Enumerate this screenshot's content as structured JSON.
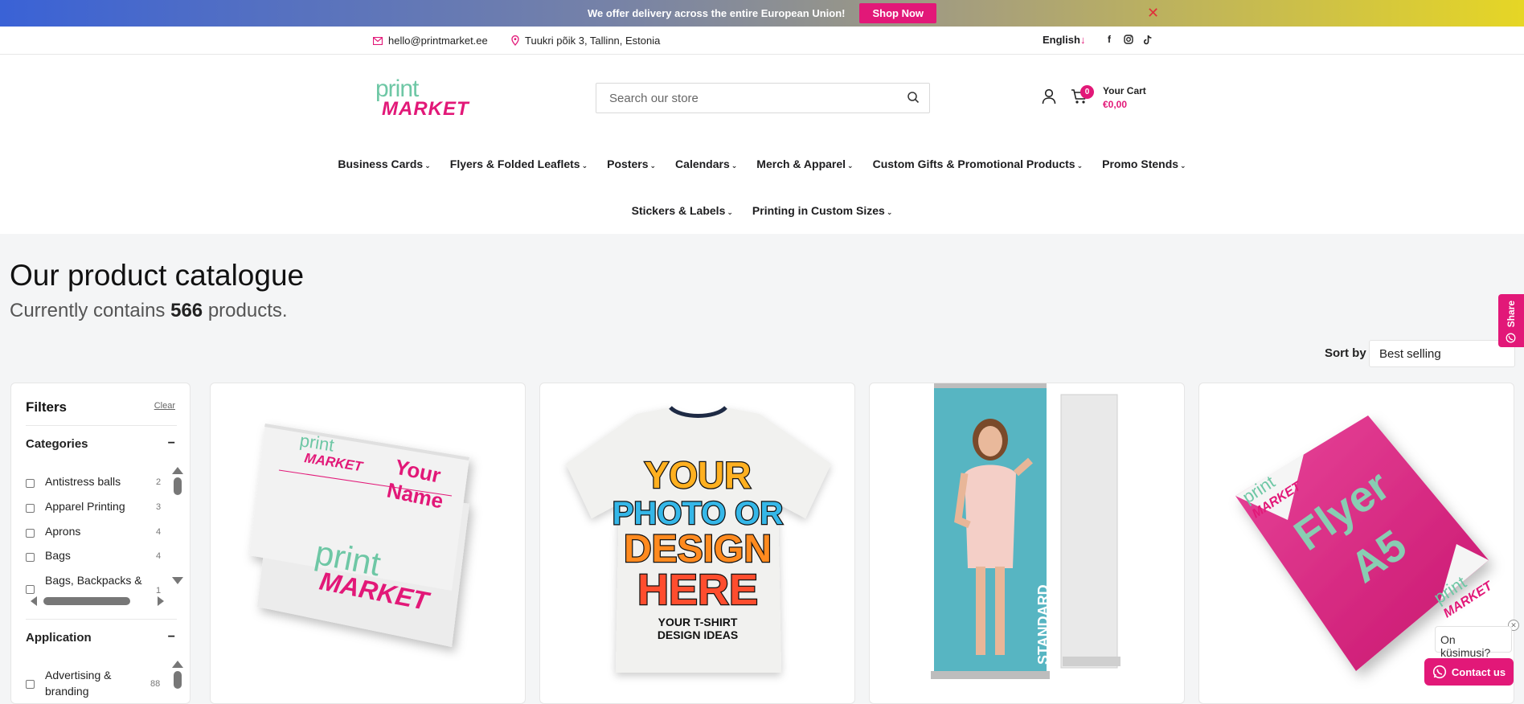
{
  "announcement": {
    "message": "We offer delivery across the entire European Union!",
    "cta": "Shop Now"
  },
  "topbar": {
    "email": "hello@printmarket.ee",
    "address": "Tuukri põik 3, Tallinn, Estonia",
    "language": "English",
    "language_arrow": "↓"
  },
  "logo": {
    "line1": "print",
    "line2": "MARKET"
  },
  "search": {
    "placeholder": "Search our store"
  },
  "cart": {
    "count": "0",
    "title": "Your Cart",
    "total": "€0,00"
  },
  "nav": {
    "row1": [
      "Business Cards",
      "Flyers & Folded Leaflets",
      "Posters",
      "Calendars",
      "Merch & Apparel",
      "Custom Gifts & Promotional Products",
      "Promo Stends"
    ],
    "row2": [
      "Stickers & Labels",
      "Printing in Custom Sizes"
    ]
  },
  "catalogue": {
    "title": "Our product catalogue",
    "subtitle_prefix": "Currently contains",
    "count": "566",
    "subtitle_suffix": "products."
  },
  "sort": {
    "label": "Sort by",
    "value": "Best selling"
  },
  "share": {
    "label": "Share"
  },
  "filters": {
    "title": "Filters",
    "clear": "Clear",
    "categories": {
      "title": "Categories",
      "toggle": "−",
      "items": [
        {
          "label": "Antistress balls",
          "count": "2"
        },
        {
          "label": "Apparel Printing",
          "count": "3"
        },
        {
          "label": "Aprons",
          "count": "4"
        },
        {
          "label": "Bags",
          "count": "4"
        },
        {
          "label": "Bags, Backpacks &",
          "count": "1"
        }
      ]
    },
    "application": {
      "title": "Application",
      "toggle": "−",
      "items": [
        {
          "label": "Advertising &",
          "label2": "branding",
          "count": "88"
        }
      ]
    }
  },
  "products": [
    {
      "name": "Business cards",
      "card_name": "Your",
      "card_name2": "Name",
      "brand1": "print",
      "brand2": "MARKET"
    },
    {
      "name": "T-shirt",
      "l1": "YOUR",
      "l2": "PHOTO OR",
      "l3": "DESIGN",
      "l4": "HERE",
      "l5": "YOUR T-SHIRT",
      "l6": "DESIGN IDEAS"
    },
    {
      "name": "Roll-up banner",
      "side": "STANDARD"
    },
    {
      "name": "Flyer A5",
      "f1": "Flyer",
      "f2": "A5",
      "brand1": "print",
      "brand2": "MARKET"
    }
  ],
  "chat": {
    "question": "On küsimusi?",
    "contact": "Contact us"
  },
  "colors": {
    "accent": "#e21878",
    "mint": "#6ec7a5"
  }
}
